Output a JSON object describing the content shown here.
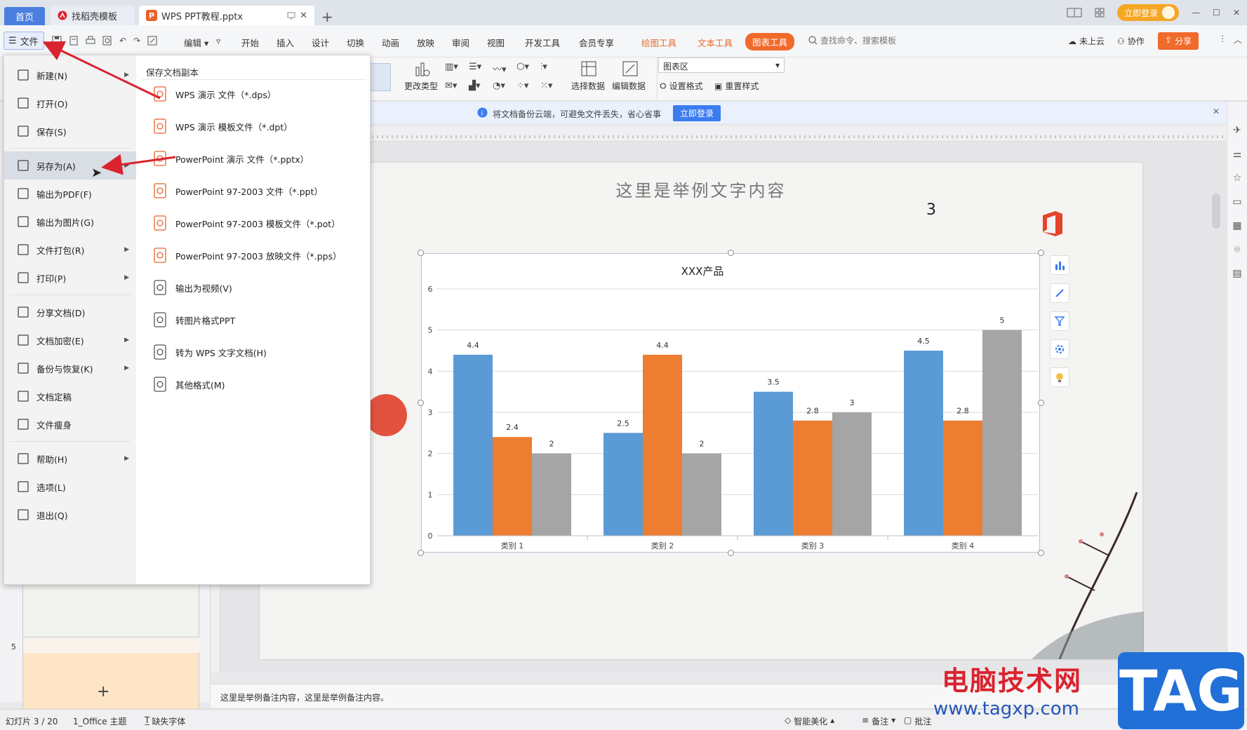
{
  "titlebar": {
    "tabs": [
      {
        "label": "首页"
      },
      {
        "label": "找稻壳模板"
      },
      {
        "label": "WPS PPT教程.pptx"
      }
    ],
    "login_label": "立即登录"
  },
  "menubar": {
    "file_label": "文件",
    "edit_label": "编辑",
    "items": [
      "开始",
      "插入",
      "设计",
      "切换",
      "动画",
      "放映",
      "审阅",
      "视图",
      "开发工具",
      "会员专享"
    ],
    "context_tabs": [
      "绘图工具",
      "文本工具",
      "图表工具"
    ],
    "search_placeholder": "查找命令、搜索模板",
    "cloud_label": "未上云",
    "collab_label": "协作",
    "share_label": "分享"
  },
  "ribbon": {
    "change_type_label": "更改类型",
    "select_data_label": "选择数据",
    "edit_data_label": "编辑数据",
    "chart_area_value": "图表区",
    "set_format_label": "设置格式",
    "reset_style_label": "重置样式"
  },
  "notice": {
    "text": "将文档备份云端，可避免文件丢失，省心省事",
    "button": "立即登录"
  },
  "file_menu": {
    "items": [
      {
        "label": "新建(N)",
        "icon": "new-file-icon",
        "submenu": true
      },
      {
        "label": "打开(O)",
        "icon": "folder-open-icon",
        "submenu": false
      },
      {
        "label": "保存(S)",
        "icon": "save-icon",
        "submenu": false
      },
      {
        "label": "另存为(A)",
        "icon": "save-as-icon",
        "submenu": true
      },
      {
        "label": "输出为PDF(F)",
        "icon": "pdf-icon",
        "submenu": false
      },
      {
        "label": "输出为图片(G)",
        "icon": "image-export-icon",
        "submenu": false
      },
      {
        "label": "文件打包(R)",
        "icon": "package-icon",
        "submenu": true
      },
      {
        "label": "打印(P)",
        "icon": "print-icon",
        "submenu": true
      },
      {
        "label": "分享文档(D)",
        "icon": "share-icon",
        "submenu": false
      },
      {
        "label": "文档加密(E)",
        "icon": "lock-icon",
        "submenu": true
      },
      {
        "label": "备份与恢复(K)",
        "icon": "backup-icon",
        "submenu": true
      },
      {
        "label": "文档定稿",
        "icon": "finalize-icon",
        "submenu": false
      },
      {
        "label": "文件瘦身",
        "icon": "slim-icon",
        "submenu": false
      },
      {
        "label": "帮助(H)",
        "icon": "help-icon",
        "submenu": true
      },
      {
        "label": "选项(L)",
        "icon": "gear-icon",
        "submenu": false
      },
      {
        "label": "退出(Q)",
        "icon": "exit-icon",
        "submenu": false
      }
    ],
    "submenu_title": "保存文档副本",
    "submenu_items": [
      {
        "label": "WPS 演示 文件（*.dps）",
        "icon": "wps-dps-icon"
      },
      {
        "label": "WPS 演示 模板文件（*.dpt）",
        "icon": "wps-dpt-icon"
      },
      {
        "label": "PowerPoint 演示 文件（*.pptx）",
        "icon": "pptx-icon"
      },
      {
        "label": "PowerPoint 97-2003 文件（*.ppt）",
        "icon": "ppt-icon"
      },
      {
        "label": "PowerPoint 97-2003 模板文件（*.pot）",
        "icon": "pot-icon"
      },
      {
        "label": "PowerPoint 97-2003 放映文件（*.pps）",
        "icon": "pps-icon"
      },
      {
        "label": "输出为视频(V)",
        "icon": "video-icon"
      },
      {
        "label": "转图片格式PPT",
        "icon": "image-ppt-icon"
      },
      {
        "label": "转为 WPS 文字文档(H)",
        "icon": "wps-word-icon"
      },
      {
        "label": "其他格式(M)",
        "icon": "question-icon"
      }
    ]
  },
  "slide": {
    "title": "这里是举例文字内容",
    "number": "3"
  },
  "thumbs": {
    "slide5_number": "5"
  },
  "chart_data": {
    "type": "bar",
    "title": "XXX产品",
    "categories": [
      "类别 1",
      "类别 2",
      "类别 3",
      "类别 4"
    ],
    "series": [
      {
        "values": [
          4.4,
          2.5,
          3.5,
          4.5
        ],
        "color": "#5b9bd5"
      },
      {
        "values": [
          2.4,
          4.4,
          2.8,
          2.8
        ],
        "color": "#ed7d31"
      },
      {
        "values": [
          2,
          2,
          3,
          5
        ],
        "color": "#a5a5a5"
      }
    ],
    "ylim": [
      0,
      6
    ],
    "yticks": [
      0,
      1,
      2,
      3,
      4,
      5,
      6
    ],
    "grid": true,
    "xlabel": "",
    "ylabel": ""
  },
  "notes": {
    "text": "这里是举例备注内容，这里是举例备注内容。"
  },
  "statusbar": {
    "slide_count": "幻灯片 3 / 20",
    "theme": "1_Office 主题",
    "missing_font": "缺失字体",
    "beautify": "智能美化",
    "notes_label": "备注",
    "comment_label": "批注"
  },
  "watermark": {
    "line1": "电脑技术网",
    "line2": "www.tagxp.com",
    "tag": "TAG"
  },
  "colors": {
    "accent_blue": "#4a7fe0",
    "accent_orange": "#f06a2c",
    "login_orange": "#f5a623"
  }
}
